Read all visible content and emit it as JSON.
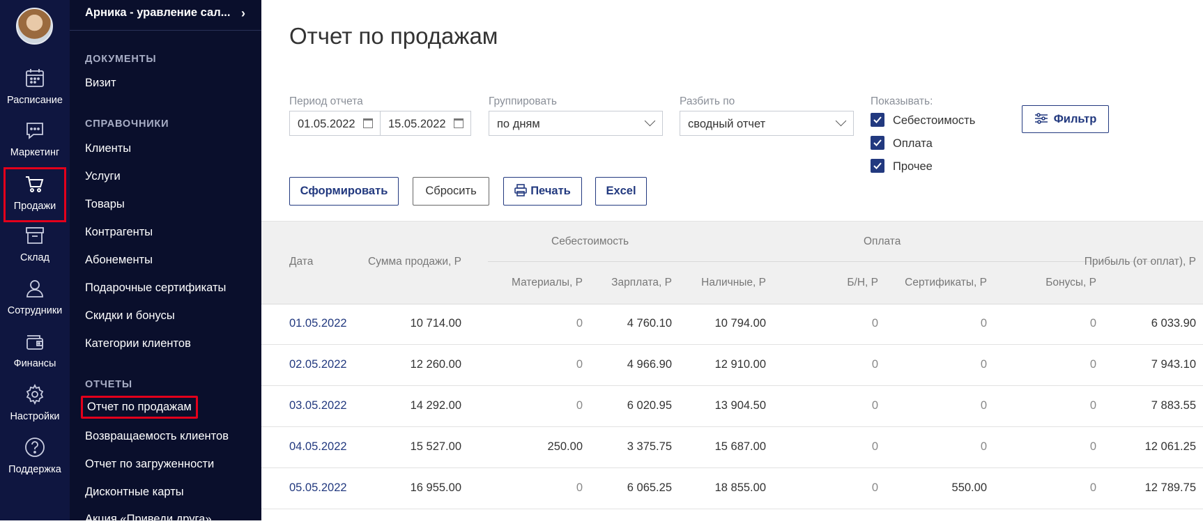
{
  "rail": {
    "items": [
      {
        "label": "Расписание",
        "icon": "calendar-icon"
      },
      {
        "label": "Маркетинг",
        "icon": "chat-icon"
      },
      {
        "label": "Продажи",
        "icon": "cart-icon"
      },
      {
        "label": "Склад",
        "icon": "box-icon"
      },
      {
        "label": "Сотрудники",
        "icon": "person-icon"
      },
      {
        "label": "Финансы",
        "icon": "wallet-icon"
      },
      {
        "label": "Настройки",
        "icon": "gear-icon"
      },
      {
        "label": "Поддержка",
        "icon": "help-icon"
      }
    ],
    "active": "Продажи"
  },
  "menu": {
    "company": "Арника - уравление сал...",
    "sections": [
      {
        "title": "ДОКУМЕНТЫ",
        "items": [
          "Визит"
        ]
      },
      {
        "title": "СПРАВОЧНИКИ",
        "items": [
          "Клиенты",
          "Услуги",
          "Товары",
          "Контрагенты",
          "Абонементы",
          "Подарочные сертификаты",
          "Скидки и бонусы",
          "Категории клиентов"
        ]
      },
      {
        "title": "ОТЧЕТЫ",
        "items": [
          "Отчет по продажам",
          "Возвращаемость клиентов",
          "Отчет по загруженности",
          "Дисконтные карты",
          "Акция «Приведи друга»"
        ]
      }
    ],
    "active_item": "Отчет по продажам"
  },
  "page": {
    "title": "Отчет по продажам"
  },
  "filters": {
    "period_label": "Период отчета",
    "date_from": "01.05.2022",
    "date_to": "15.05.2022",
    "group_label": "Группировать",
    "group_value": "по дням",
    "split_label": "Разбить по",
    "split_value": "сводный отчет",
    "show_label": "Показывать:",
    "show_options": [
      {
        "label": "Себестоимость",
        "checked": true
      },
      {
        "label": "Оплата",
        "checked": true
      },
      {
        "label": "Прочее",
        "checked": true
      }
    ],
    "filter_button": "Фильтр"
  },
  "actions": {
    "generate": "Сформировать",
    "reset": "Сбросить",
    "print": "Печать",
    "excel": "Excel"
  },
  "table": {
    "group_headers": {
      "cost": "Себестоимость",
      "payment": "Оплата"
    },
    "columns": {
      "date": "Дата",
      "sale_sum": "Сумма продажи, Р",
      "materials": "Материалы, Р",
      "salary": "Зарплата, Р",
      "cash": "Наличные, Р",
      "cashless": "Б/Н, Р",
      "certificates": "Сертификаты, Р",
      "bonuses": "Бонусы, Р",
      "profit": "Прибыль (от оплат), Р"
    },
    "rows": [
      {
        "date": "01.05.2022",
        "sale_sum": "10 714.00",
        "materials": "0",
        "salary": "4 760.10",
        "cash": "10 794.00",
        "cashless": "0",
        "certificates": "0",
        "bonuses": "0",
        "profit": "6 033.90"
      },
      {
        "date": "02.05.2022",
        "sale_sum": "12 260.00",
        "materials": "0",
        "salary": "4 966.90",
        "cash": "12 910.00",
        "cashless": "0",
        "certificates": "0",
        "bonuses": "0",
        "profit": "7 943.10"
      },
      {
        "date": "03.05.2022",
        "sale_sum": "14 292.00",
        "materials": "0",
        "salary": "6 020.95",
        "cash": "13 904.50",
        "cashless": "0",
        "certificates": "0",
        "bonuses": "0",
        "profit": "7 883.55"
      },
      {
        "date": "04.05.2022",
        "sale_sum": "15 527.00",
        "materials": "250.00",
        "salary": "3 375.75",
        "cash": "15 687.00",
        "cashless": "0",
        "certificates": "0",
        "bonuses": "0",
        "profit": "12 061.25"
      },
      {
        "date": "05.05.2022",
        "sale_sum": "16 955.00",
        "materials": "0",
        "salary": "6 065.25",
        "cash": "18 855.00",
        "cashless": "0",
        "certificates": "550.00",
        "bonuses": "0",
        "profit": "12 789.75"
      }
    ]
  },
  "colors": {
    "rail_bg": "#0f1640",
    "menu_bg": "#0a0f2c",
    "accent": "#22397f",
    "highlight": "#e3001b"
  }
}
